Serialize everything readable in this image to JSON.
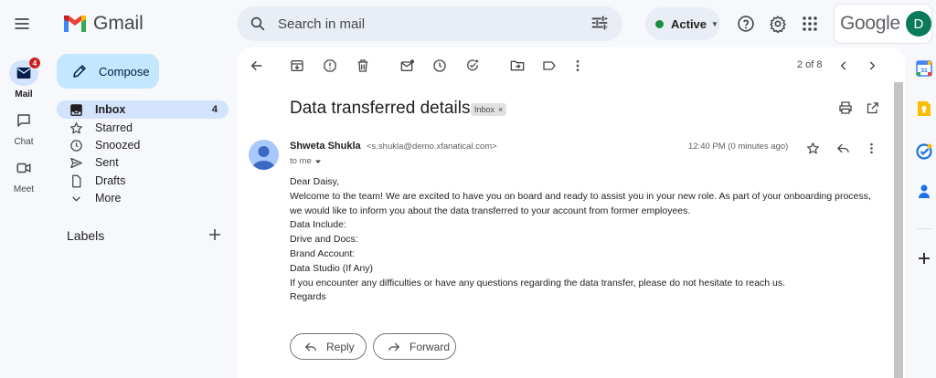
{
  "app": {
    "logo_text": "Gmail",
    "brand": "Google",
    "account_initial": "D"
  },
  "search": {
    "placeholder": "Search in mail"
  },
  "status": {
    "label": "Active",
    "color": "#1e8e3e"
  },
  "rail": [
    {
      "label": "Mail",
      "badge": "4",
      "icon": "mail-icon"
    },
    {
      "label": "Chat",
      "icon": "chat-icon"
    },
    {
      "label": "Meet",
      "icon": "video-icon"
    }
  ],
  "compose": {
    "label": "Compose"
  },
  "nav": [
    {
      "label": "Inbox",
      "count": "4",
      "icon": "inbox-icon"
    },
    {
      "label": "Starred",
      "icon": "star-icon"
    },
    {
      "label": "Snoozed",
      "icon": "clock-icon"
    },
    {
      "label": "Sent",
      "icon": "send-icon"
    },
    {
      "label": "Drafts",
      "icon": "draft-icon"
    },
    {
      "label": "More",
      "icon": "chevron-down-icon"
    }
  ],
  "labels": {
    "heading": "Labels"
  },
  "toolbar": {
    "pager": "2 of 8"
  },
  "message": {
    "subject": "Data transferred details",
    "folder_chip": "Inbox",
    "sender_name": "Shweta Shukla",
    "sender_email": "<s.shukla@demo.xfanatical.com>",
    "to": "to me",
    "time": "12:40 PM (0 minutes ago)",
    "body_lines": [
      "Dear Daisy,",
      "Welcome to the team! We are excited to have you on board and ready to assist you in your new role. As part of your onboarding process,",
      "we would like to inform you about the data transferred to your account from former employees.",
      "Data Include:",
      "Drive and Docs:",
      "Brand Account:",
      "Data Studio (If Any)",
      "If you encounter any difficulties or have any questions regarding the data transfer, please do not hesitate to reach us.",
      "Regards"
    ]
  },
  "actions": {
    "reply": "Reply",
    "forward": "Forward"
  },
  "colors": {
    "accent": "#c2e7ff",
    "selected": "#d3e3fd",
    "background": "#f6f8fc",
    "badge": "#c5221f"
  }
}
